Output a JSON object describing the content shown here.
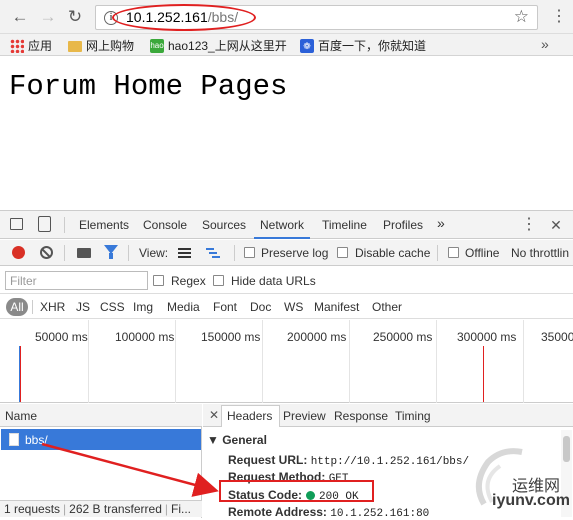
{
  "browser": {
    "url_host": "10.1.252.161",
    "url_path": "/bbs/",
    "bookmarks": [
      {
        "label": "应用"
      },
      {
        "label": "网上购物"
      },
      {
        "label": "hao123_上网从这里开"
      },
      {
        "label": "百度一下，你就知道"
      }
    ]
  },
  "page": {
    "heading": "Forum Home Pages"
  },
  "devtools": {
    "tabs": [
      "Elements",
      "Console",
      "Sources",
      "Network",
      "Timeline",
      "Profiles"
    ],
    "active_tab": "Network",
    "controls": {
      "view_label": "View:",
      "preserve_log": "Preserve log",
      "disable_cache": "Disable cache",
      "offline": "Offline",
      "throttling": "No throttlin"
    },
    "filter": {
      "placeholder": "Filter",
      "regex": "Regex",
      "hide_data_urls": "Hide data URLs"
    },
    "types": [
      "All",
      "XHR",
      "JS",
      "CSS",
      "Img",
      "Media",
      "Font",
      "Doc",
      "WS",
      "Manifest",
      "Other"
    ],
    "timeline_ticks": [
      "50000 ms",
      "100000 ms",
      "150000 ms",
      "200000 ms",
      "250000 ms",
      "300000 ms",
      "35000"
    ],
    "name_header": "Name",
    "requests": [
      "bbs/"
    ],
    "detail_tabs": [
      "Headers",
      "Preview",
      "Response",
      "Timing"
    ],
    "active_detail_tab": "Headers",
    "general": {
      "title": "General",
      "request_url_label": "Request URL:",
      "request_url": "http://10.1.252.161/bbs/",
      "request_method_label": "Request Method:",
      "request_method": "GET",
      "status_code_label": "Status Code:",
      "status_code": "200 OK",
      "remote_address_label": "Remote Address:",
      "remote_address": "10.1.252.161:80"
    },
    "summary": {
      "requests": "1 requests",
      "transferred": "262 B transferred",
      "finish": "Fi..."
    }
  },
  "watermark": {
    "top": "运维网",
    "bottom": "iyunv.com"
  },
  "colors": {
    "accent": "#3879d9",
    "annotation": "#e02020",
    "status_ok": "#0f9d58"
  }
}
